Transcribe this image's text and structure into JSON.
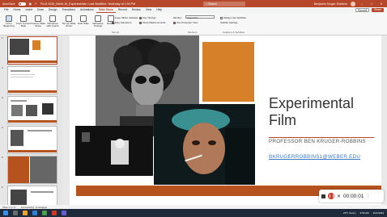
{
  "titlebar": {
    "autosave_label": "AutoSave",
    "doc_title": "FILM 2030_Week 10_Experimental • Last Modified: Yesterday at 1:00 PM",
    "search_placeholder": "Search",
    "user_name": "Benjamin Kruger-Robbins"
  },
  "ribbon_tabs": [
    "File",
    "Home",
    "Insert",
    "Draw",
    "Design",
    "Transitions",
    "Animations",
    "Slide Show",
    "Record",
    "Review",
    "View",
    "Help"
  ],
  "active_tab": "Slide Show",
  "record_label": "Record",
  "share_label": "Share",
  "ribbon": {
    "buttons": [
      {
        "label": "From Beginning",
        "active": true
      },
      {
        "label": "From Current Slide",
        "active": false
      },
      {
        "label": "Custom Slide Show",
        "active": false
      },
      {
        "label": "Rehearse with Coach",
        "active": false
      },
      {
        "label": "Set Up Slide Show",
        "active": false
      },
      {
        "label": "Hide Slide",
        "active": false
      },
      {
        "label": "Rehearse Timings",
        "active": false
      },
      {
        "label": "Record",
        "active": false
      }
    ],
    "checkboxes": [
      {
        "label": "Keep Slides Updated",
        "checked": true
      },
      {
        "label": "Play Narrations",
        "checked": true
      },
      {
        "label": "Use Timings",
        "checked": true
      },
      {
        "label": "Show Media Controls",
        "checked": true
      },
      {
        "label": "Use Presenter View",
        "checked": true
      },
      {
        "label": "Always Use Subtitles",
        "checked": false
      }
    ],
    "monitor_label": "Monitor:",
    "monitor_value": "Automatic",
    "subtitle_settings": "Subtitle Settings",
    "groups": [
      "Set Up",
      "Monitors",
      "Captions & Subtitles"
    ]
  },
  "thumbnails": [
    {
      "num": "1"
    },
    {
      "num": "2"
    },
    {
      "num": "3"
    },
    {
      "num": "4"
    },
    {
      "num": "5"
    },
    {
      "num": "6"
    }
  ],
  "slide": {
    "title": "Experimental Film",
    "subtitle": "PROFESSOR BEN KRUGER-ROBBINS",
    "email": "BKRUGERROBBINS1@WEBER.EDU"
  },
  "status": {
    "slide_count": "Slide 1 of 17",
    "accessibility": "Accessibility: Investigate"
  },
  "recorder": {
    "time": "00:00:01"
  },
  "taskbar": {
    "weather": "23°F Sunny",
    "clock": "9:59 AM",
    "date": "3/21/2023"
  },
  "colors": {
    "accent": "#b7472a",
    "orange": "#d7802a",
    "band": "#b5521d"
  }
}
